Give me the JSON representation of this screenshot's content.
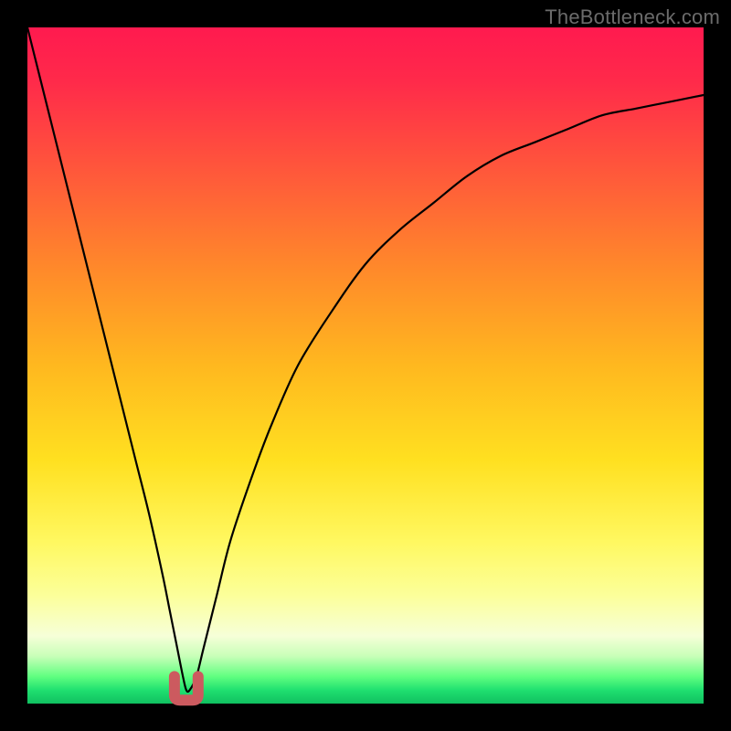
{
  "attribution": "TheBottleneck.com",
  "chart_data": {
    "type": "line",
    "title": "",
    "xlabel": "",
    "ylabel": "",
    "xlim": [
      0,
      100
    ],
    "ylim": [
      0,
      100
    ],
    "grid": false,
    "legend": false,
    "annotations": [],
    "series": [
      {
        "name": "bottleneck-curve",
        "color": "#000000",
        "x": [
          0,
          2,
          4,
          6,
          8,
          10,
          12,
          14,
          16,
          18,
          20,
          21,
          22,
          23,
          23.5,
          24,
          25,
          26,
          28,
          30,
          33,
          36,
          40,
          45,
          50,
          55,
          60,
          65,
          70,
          75,
          80,
          85,
          90,
          95,
          100
        ],
        "values": [
          100,
          92,
          84,
          76,
          68,
          60,
          52,
          44,
          36,
          28,
          19,
          14,
          9,
          4,
          2,
          2,
          4,
          8,
          16,
          24,
          33,
          41,
          50,
          58,
          65,
          70,
          74,
          78,
          81,
          83,
          85,
          87,
          88,
          89,
          90
        ]
      },
      {
        "name": "vertex-marker",
        "color": "#cc5a5f",
        "type": "marker-u",
        "x_center": 23.5,
        "y_bottom": 0.5,
        "width": 3.5,
        "height": 3.5
      }
    ]
  }
}
